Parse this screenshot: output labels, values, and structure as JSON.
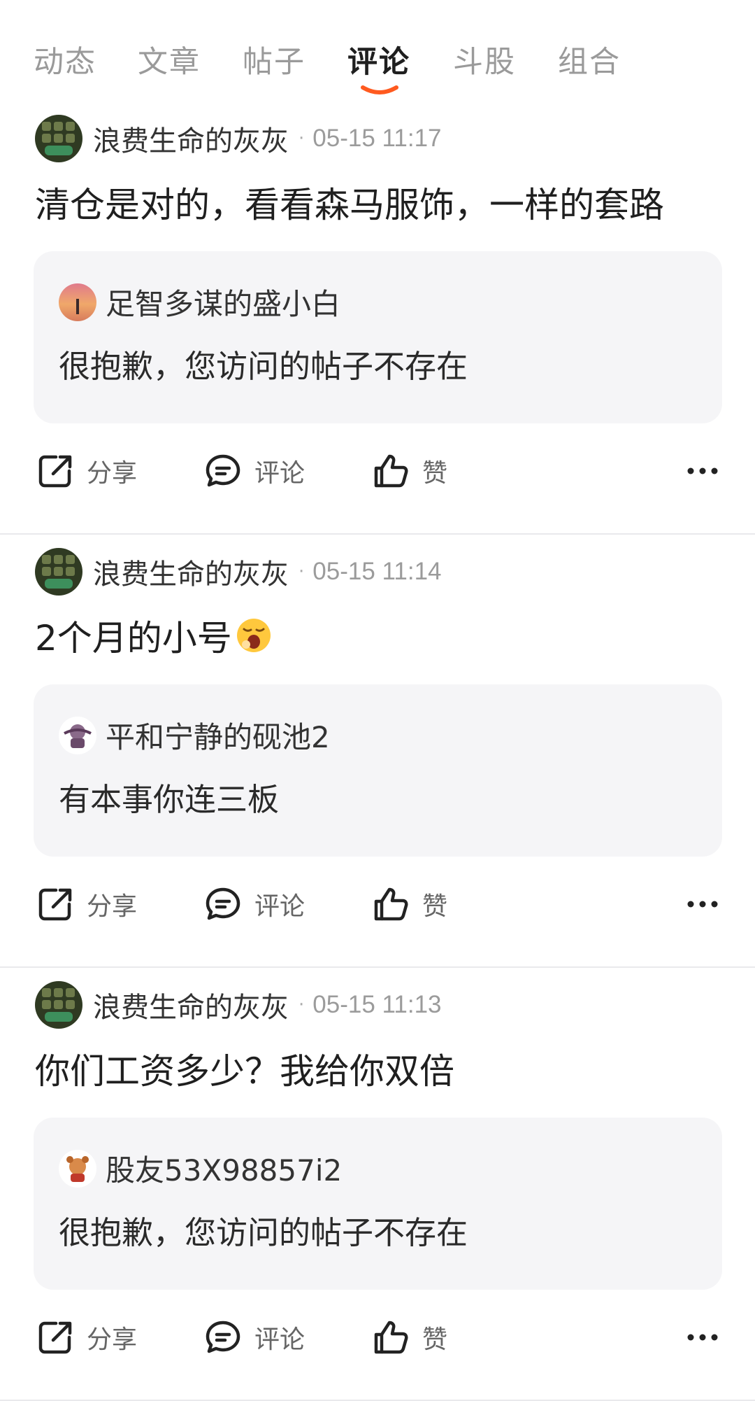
{
  "tabs": [
    {
      "label": "动态"
    },
    {
      "label": "文章"
    },
    {
      "label": "帖子"
    },
    {
      "label": "评论"
    },
    {
      "label": "斗股"
    },
    {
      "label": "组合"
    }
  ],
  "active_tab": "评论",
  "colors": {
    "accent": "#ff5a1f",
    "quote_bg": "#f5f5f7",
    "divider": "#e9e9ec"
  },
  "posts": [
    {
      "author": "浪费生命的灰灰",
      "time": "05-15 11:17",
      "content": "清仓是对的，看看森马服饰，一样的套路",
      "quote": {
        "author": "足智多谋的盛小白",
        "text": "很抱歉，您访问的帖子不存在"
      },
      "actions": {
        "share": "分享",
        "comment": "评论",
        "like": "赞"
      }
    },
    {
      "author": "浪费生命的灰灰",
      "time": "05-15 11:14",
      "content": "2个月的小号",
      "content_emoji": "yawning-face-icon",
      "quote": {
        "author": "平和宁静的砚池2",
        "text": "有本事你连三板"
      },
      "actions": {
        "share": "分享",
        "comment": "评论",
        "like": "赞"
      }
    },
    {
      "author": "浪费生命的灰灰",
      "time": "05-15 11:13",
      "content": "你们工资多少？我给你双倍",
      "quote": {
        "author": "股友53X98857i2",
        "text": "很抱歉，您访问的帖子不存在"
      },
      "actions": {
        "share": "分享",
        "comment": "评论",
        "like": "赞"
      }
    }
  ]
}
